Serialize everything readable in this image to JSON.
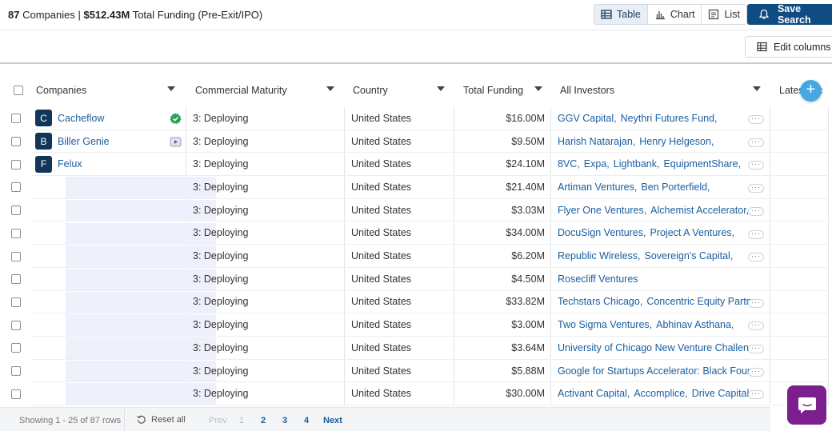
{
  "summary": {
    "count": "87",
    "label_companies": "Companies |",
    "amount": "$512.43M",
    "label_funding": "Total Funding (Pre-Exit/IPO)"
  },
  "views": {
    "table": "Table",
    "chart": "Chart",
    "list": "List"
  },
  "save_search": "Save Search",
  "edit_columns": "Edit columns",
  "columns": {
    "companies": "Companies",
    "maturity": "Commercial Maturity",
    "country": "Country",
    "funding": "Total Funding",
    "investors": "All Investors",
    "latest": "Latest Inc"
  },
  "rows": [
    {
      "logo": "C",
      "name": "Cacheflow",
      "maturity": "3: Deploying",
      "country": "United States",
      "funding": "$16.00M",
      "investors": [
        "GGV Capital,",
        "Neythri Futures Fund,"
      ],
      "more": true
    },
    {
      "logo": "B",
      "name": "Biller Genie",
      "maturity": "3: Deploying",
      "country": "United States",
      "funding": "$9.50M",
      "investors": [
        "Harish Natarajan,",
        "Henry Helgeson,"
      ],
      "more": true
    },
    {
      "logo": "F",
      "name": "Felux",
      "maturity": "3: Deploying",
      "country": "United States",
      "funding": "$24.10M",
      "investors": [
        "8VC,",
        "Expa,",
        "Lightbank,",
        "EquipmentShare,"
      ],
      "more": true
    },
    {
      "logo": "",
      "name": "",
      "maturity": "3: Deploying",
      "country": "United States",
      "funding": "$21.40M",
      "investors": [
        "Artiman Ventures,",
        "Ben Porterfield,"
      ],
      "more": true
    },
    {
      "logo": "",
      "name": "",
      "maturity": "3: Deploying",
      "country": "United States",
      "funding": "$3.03M",
      "investors": [
        "Flyer One Ventures,",
        "Alchemist Accelerator,"
      ],
      "more": true
    },
    {
      "logo": "",
      "name": "",
      "maturity": "3: Deploying",
      "country": "United States",
      "funding": "$34.00M",
      "investors": [
        "DocuSign Ventures,",
        "Project A Ventures,"
      ],
      "more": true
    },
    {
      "logo": "",
      "name": "",
      "maturity": "3: Deploying",
      "country": "United States",
      "funding": "$6.20M",
      "investors": [
        "Republic Wireless,",
        "Sovereign's Capital,"
      ],
      "more": true
    },
    {
      "logo": "",
      "name": "",
      "maturity": "3: Deploying",
      "country": "United States",
      "funding": "$4.50M",
      "investors": [
        "Rosecliff Ventures"
      ],
      "more": false
    },
    {
      "logo": "",
      "name": "",
      "maturity": "3: Deploying",
      "country": "United States",
      "funding": "$33.82M",
      "investors": [
        "Techstars Chicago,",
        "Concentric Equity Partners,"
      ],
      "more": true
    },
    {
      "logo": "",
      "name": "",
      "maturity": "3: Deploying",
      "country": "United States",
      "funding": "$3.00M",
      "investors": [
        "Two Sigma Ventures,",
        "Abhinav Asthana,"
      ],
      "more": true
    },
    {
      "logo": "",
      "name": "",
      "maturity": "3: Deploying",
      "country": "United States",
      "funding": "$3.64M",
      "investors": [
        "University of Chicago New Venture Challenge,"
      ],
      "more": true
    },
    {
      "logo": "",
      "name": "",
      "maturity": "3: Deploying",
      "country": "United States",
      "funding": "$5.88M",
      "investors": [
        "Google for Startups Accelerator: Black Founders"
      ],
      "more": true
    },
    {
      "logo": "",
      "name": "",
      "maturity": "3: Deploying",
      "country": "United States",
      "funding": "$30.00M",
      "investors": [
        "Activant Capital,",
        "Accomplice,",
        "Drive Capital,"
      ],
      "more": true
    }
  ],
  "footer": {
    "rows_info": "Showing 1 - 25 of 87 rows",
    "reset_all": "Reset all",
    "prev": "Prev",
    "pages": [
      "1",
      "2",
      "3",
      "4"
    ],
    "next": "Next"
  },
  "colors": {
    "primary": "#0f4c81",
    "link": "#1a5fa0",
    "add_column": "#45a8e3",
    "chat": "#7b1f8e",
    "verified": "#2aa05a"
  }
}
